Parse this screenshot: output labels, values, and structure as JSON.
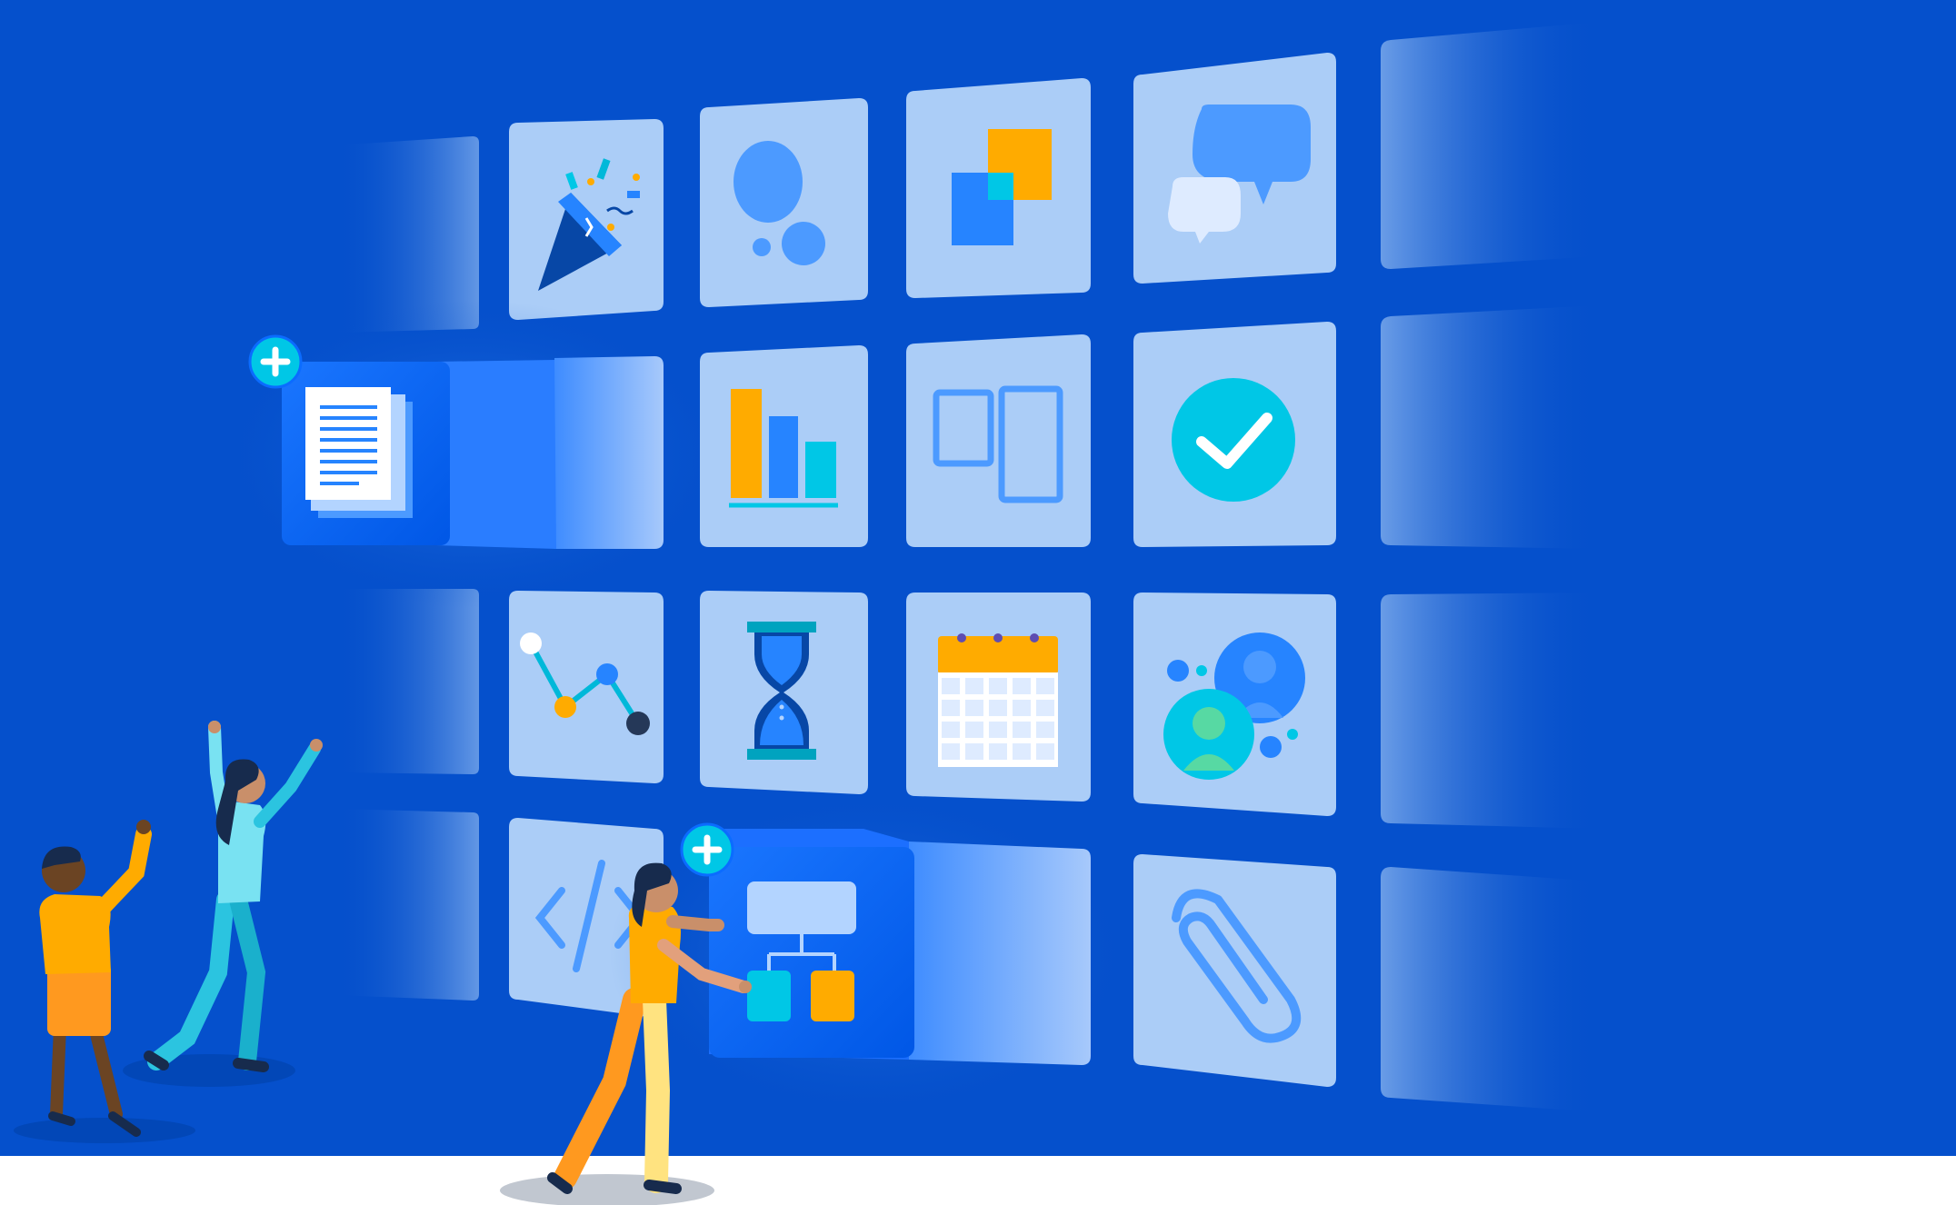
{
  "colors": {
    "background": "#0550cc",
    "floor": "#ffffff",
    "tile": "#abcdf7",
    "tile_faded": "#6b9be3",
    "card_glow": "#0b6cff",
    "icon_blue": "#4c9aff",
    "icon_orange": "#ffab00",
    "icon_teal": "#00c7e6",
    "figure_yellow": "#ffb700",
    "figure_teal": "#2bc4e0",
    "figure_dark": "#172b4d"
  },
  "tiles": [
    {
      "row": 0,
      "icon": "party-popper-icon"
    },
    {
      "row": 0,
      "icon": "bubbles-icon"
    },
    {
      "row": 0,
      "icon": "layered-squares-icon"
    },
    {
      "row": 0,
      "icon": "chat-bubbles-icon"
    },
    {
      "row": 1,
      "icon": "document-icon"
    },
    {
      "row": 1,
      "icon": "bar-chart-icon"
    },
    {
      "row": 1,
      "icon": "two-panels-icon"
    },
    {
      "row": 1,
      "icon": "checkmark-icon"
    },
    {
      "row": 2,
      "icon": "line-graph-icon"
    },
    {
      "row": 2,
      "icon": "hourglass-icon"
    },
    {
      "row": 2,
      "icon": "calendar-icon"
    },
    {
      "row": 2,
      "icon": "people-avatars-icon"
    },
    {
      "row": 3,
      "icon": "code-brackets-icon"
    },
    {
      "row": 3,
      "icon": "flowchart-icon"
    },
    {
      "row": 3,
      "icon": "paperclip-icon"
    }
  ],
  "add_badges": [
    {
      "icon": "plus-icon",
      "target": "document-card"
    },
    {
      "icon": "plus-icon",
      "target": "flowchart-card"
    }
  ],
  "people": [
    {
      "name": "pointing-person"
    },
    {
      "name": "cheering-person"
    },
    {
      "name": "pushing-person"
    }
  ]
}
